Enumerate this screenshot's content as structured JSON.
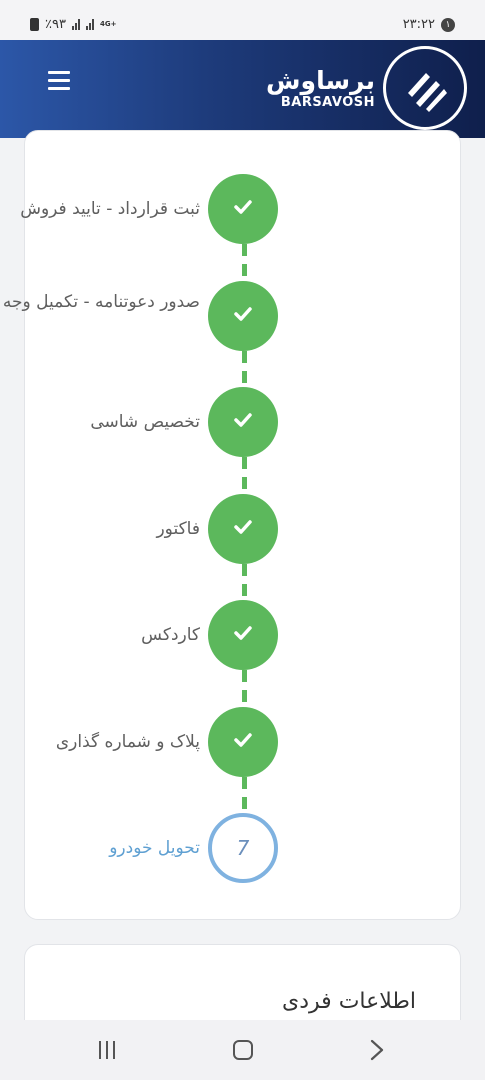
{
  "status_bar": {
    "battery": "٪۹۳",
    "network": "4G+",
    "time": "۲۳:۲۲",
    "notification_count": "۱"
  },
  "header": {
    "brand_fa": "برساوش",
    "brand_en": "BARSAVOSH"
  },
  "steps": [
    {
      "label": "ثبت قرارداد - تایید فروش",
      "status": "done"
    },
    {
      "label": "صدور دعوتنامه - تکمیل وجه",
      "status": "done"
    },
    {
      "label": "تخصیص شاسی",
      "status": "done"
    },
    {
      "label": "فاکتور",
      "status": "done"
    },
    {
      "label": "کاردکس",
      "status": "done"
    },
    {
      "label": "پلاک و شماره گذاری",
      "status": "done"
    },
    {
      "label": "تحویل خودرو",
      "status": "pending",
      "number": "7"
    }
  ],
  "section2": {
    "title": "اطلاعات فردی"
  },
  "colors": {
    "header_start": "#2c57a8",
    "header_end": "#0f1f4c",
    "done": "#5cb85c",
    "pending_border": "#7fb2e0",
    "pending_text": "#5fa0d2"
  }
}
